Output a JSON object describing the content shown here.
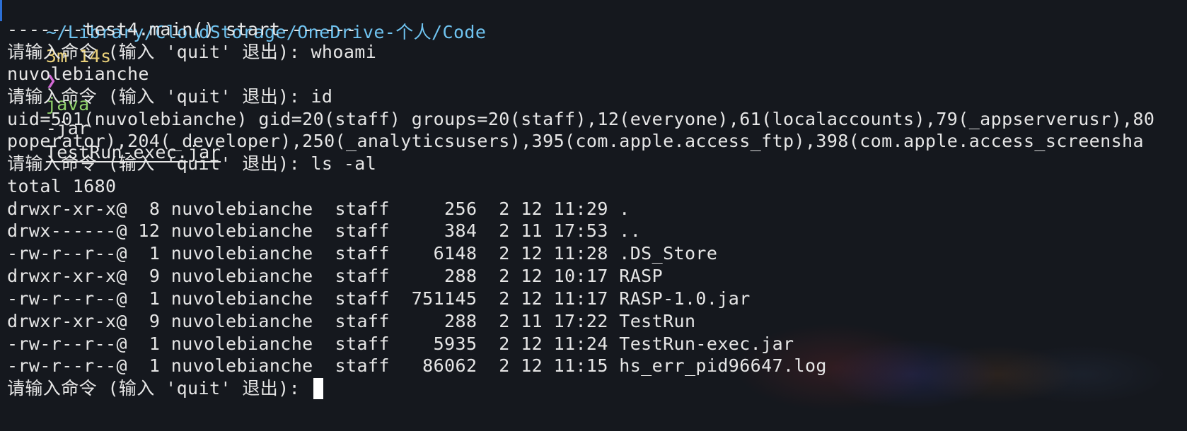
{
  "prompt": {
    "path": "~/Library/CloudStorage/OneDrive-个人/Code",
    "duration": "3m 14s",
    "arrow": "❯",
    "command": "java",
    "flag": "-jar",
    "file": "TestRun-exec.jar"
  },
  "lines": [
    "-------test4.main() start-------",
    "请输入命令 (输入 'quit' 退出): whoami",
    "nuvolebianche",
    "请输入命令 (输入 'quit' 退出): id",
    "uid=501(nuvolebianche) gid=20(staff) groups=20(staff),12(everyone),61(localaccounts),79(_appserverusr),80",
    "poperator),204(_developer),250(_analyticsusers),395(com.apple.access_ftp),398(com.apple.access_screensha",
    "请输入命令 (输入 'quit' 退出): ls -al",
    "total 1680",
    "drwxr-xr-x@  8 nuvolebianche  staff     256  2 12 11:29 .",
    "drwx------@ 12 nuvolebianche  staff     384  2 11 17:53 ..",
    "-rw-r--r--@  1 nuvolebianche  staff    6148  2 12 11:28 .DS_Store",
    "drwxr-xr-x@  9 nuvolebianche  staff     288  2 12 10:17 RASP",
    "-rw-r--r--@  1 nuvolebianche  staff  751145  2 12 11:17 RASP-1.0.jar",
    "drwxr-xr-x@  9 nuvolebianche  staff     288  2 11 17:22 TestRun",
    "-rw-r--r--@  1 nuvolebianche  staff    5935  2 12 11:24 TestRun-exec.jar",
    "-rw-r--r--@  1 nuvolebianche  staff   86062  2 12 11:15 hs_err_pid96647.log"
  ],
  "current_prompt": "请输入命令 (输入 'quit' 退出): "
}
